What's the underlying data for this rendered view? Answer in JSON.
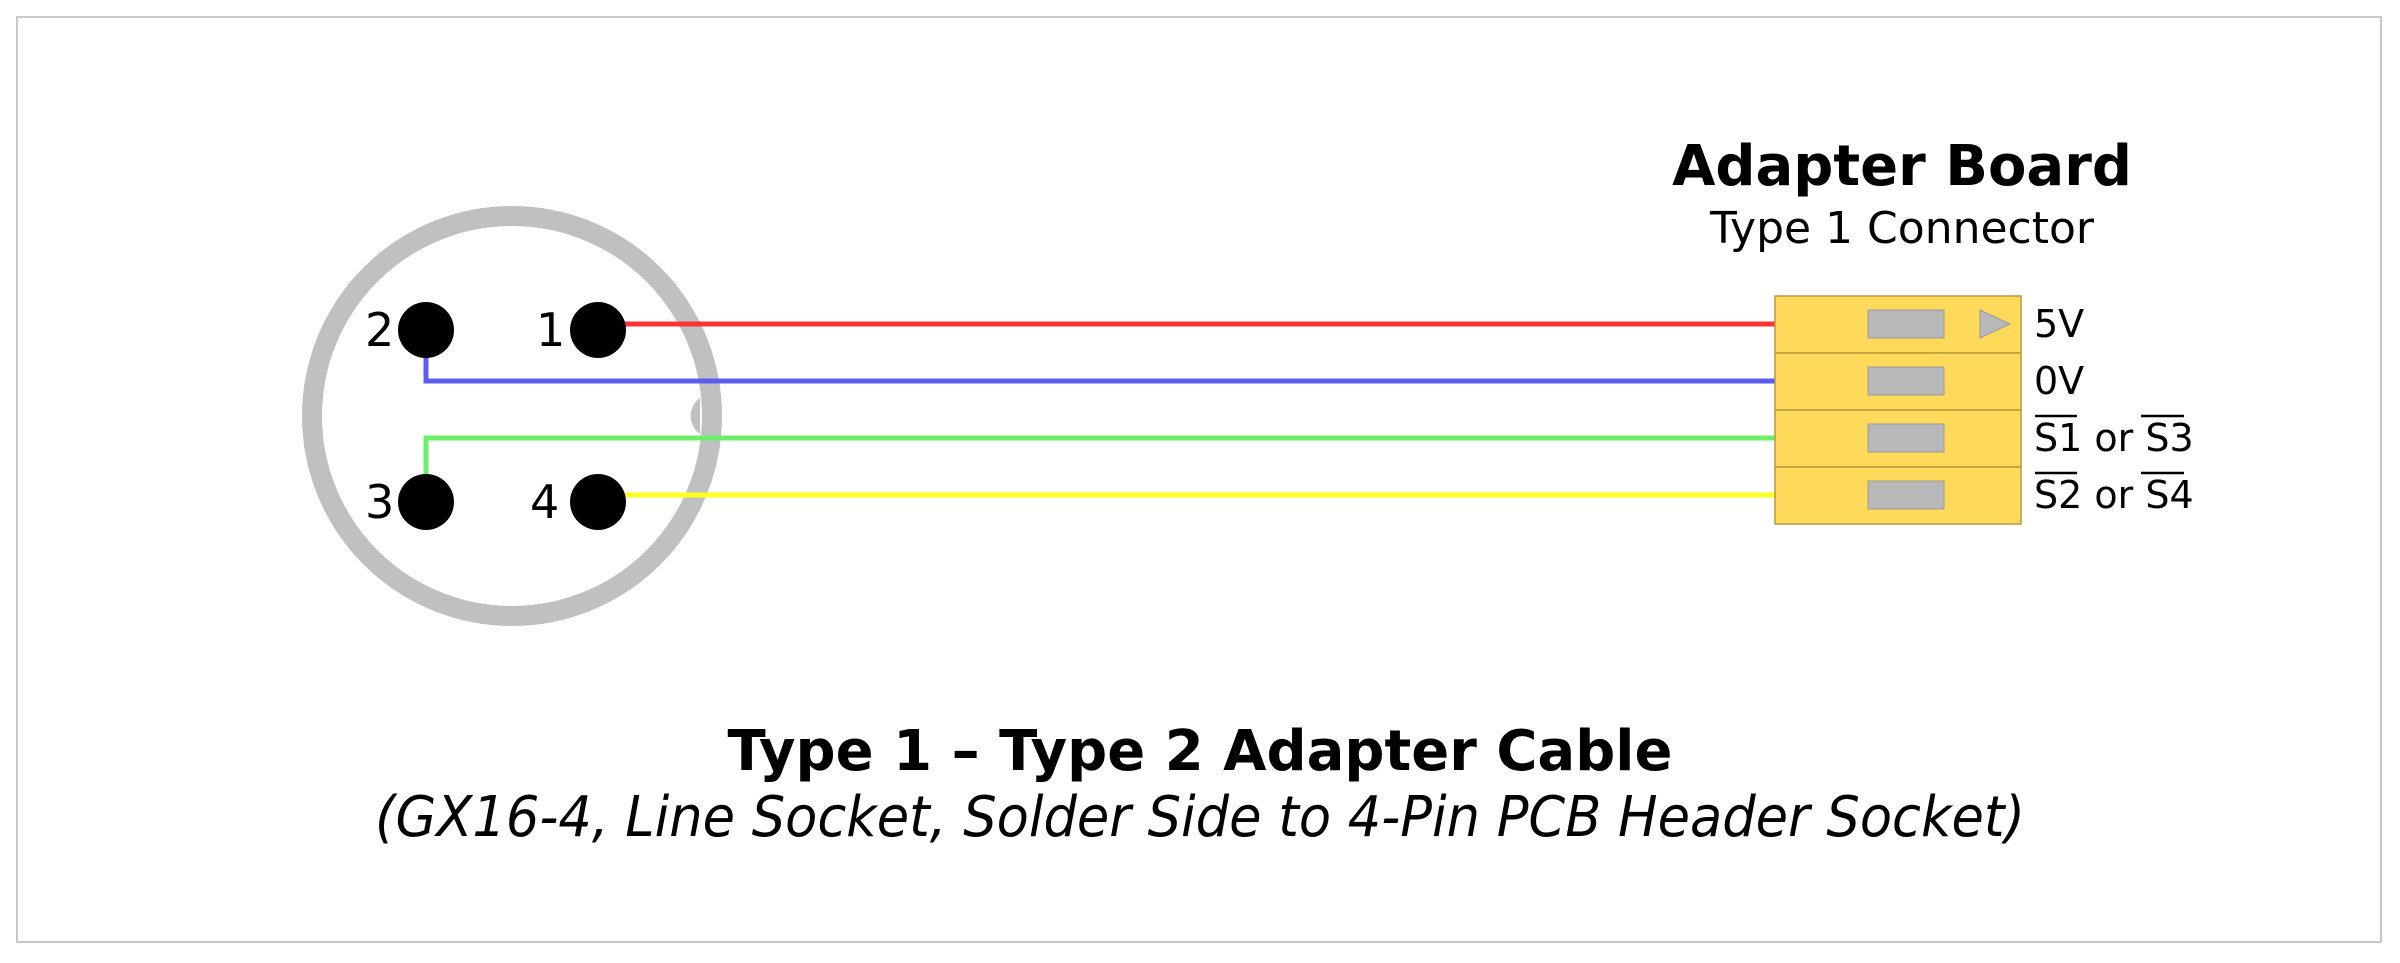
{
  "connector": {
    "pins": [
      {
        "number": "1"
      },
      {
        "number": "2"
      },
      {
        "number": "3"
      },
      {
        "number": "4"
      }
    ]
  },
  "wires": [
    {
      "pin": "1",
      "color": "#ff3333",
      "signal": "5V"
    },
    {
      "pin": "2",
      "color": "#5b5bf0",
      "signal": "0V"
    },
    {
      "pin": "3",
      "color": "#6cf06c",
      "signal": "S1 or S3"
    },
    {
      "pin": "4",
      "color": "#ffff22",
      "signal": "S2 or S4"
    }
  ],
  "adapter_board": {
    "title": "Adapter Board",
    "subtitle": "Type 1 Connector",
    "signals": [
      {
        "label": "5V",
        "parts": [
          {
            "text": "5V",
            "overline": false
          }
        ]
      },
      {
        "label": "0V",
        "parts": [
          {
            "text": "0V",
            "overline": false
          }
        ]
      },
      {
        "label": "S1 or S3",
        "parts": [
          {
            "text": "S1",
            "overline": true
          },
          {
            "text": " or ",
            "overline": false
          },
          {
            "text": "S3",
            "overline": true
          }
        ]
      },
      {
        "label": "S2 or S4",
        "parts": [
          {
            "text": "S2",
            "overline": true
          },
          {
            "text": " or ",
            "overline": false
          },
          {
            "text": "S4",
            "overline": true
          }
        ]
      }
    ]
  },
  "caption": {
    "title": "Type 1 – Type 2 Adapter Cable",
    "subtitle": "(GX16-4, Line Socket, Solder Side to 4-Pin PCB Header Socket)"
  },
  "colors": {
    "connector_ring": "#c0c0c0",
    "connector_body": "#ffffff",
    "pin": "#000000",
    "header_fill": "#ffd95a",
    "header_border": "#b89a40",
    "contact_fill": "#b8b8b8",
    "frame": "#c8c8c8"
  }
}
